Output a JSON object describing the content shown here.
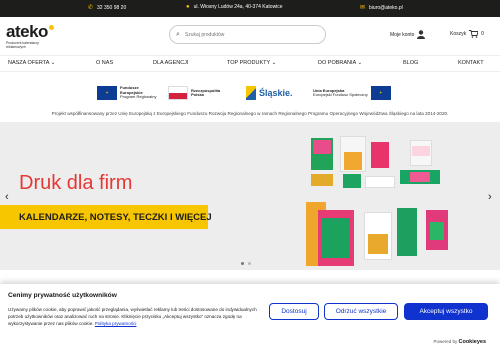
{
  "topbar": {
    "phone": "32 350 98 20",
    "address": "ul. Wiosny Ludów 24a, 40-374 Katowice",
    "email": "biuro@ateko.pl",
    "icons": {
      "phone": "phone-icon",
      "address": "location-pin-icon",
      "email": "envelope-icon"
    }
  },
  "header": {
    "logo_text": "ateko",
    "logo_tagline": "Producent kalendarzy reklamowych",
    "search_placeholder": "Szukaj produktów",
    "account_label": "Moje konto",
    "cart_label": "Koszyk",
    "cart_count": "0"
  },
  "nav": {
    "items": [
      "NASZA OFERTA",
      "O NAS",
      "DLA AGENCJI",
      "TOP PRODUKTY",
      "DO POBRANIA",
      "BLOG",
      "KONTAKT"
    ]
  },
  "funding": {
    "logos": [
      {
        "line1": "Fundusze",
        "line2": "Europejskie",
        "line3": "Program Regionalny"
      },
      {
        "line1": "Rzeczpospolita",
        "line2": "Polska"
      },
      {
        "text": "Śląskie."
      },
      {
        "line1": "Unia Europejska",
        "line2": "Europejski Fundusz Społeczny"
      }
    ],
    "note": "Projekt współfinansowany przez Unię Europejską z Europejskiego Funduszu Rozwoju Regionalnego w ramach Regionalnego Programu Operacyjnego Województwa Śląskiego na lata 2014-2020."
  },
  "hero": {
    "title": "Druk dla firm",
    "subtitle": "KALENDARZE, NOTESY, TECZKI I WIĘCEJ",
    "slides": 2,
    "active_slide": 1
  },
  "cookie": {
    "title": "Cenimy prywatność użytkowników",
    "text": "Używamy plików cookie, aby poprawić jakość przeglądania, wyświetlać reklamy lub treści dostosowane do indywidualnych potrzeb użytkowników oraz analizować ruch na stronie. Kliknięcie przycisku „Akceptuj wszystko” oznacza zgodę na wykorzystywanie przez nas plików cookie.",
    "policy_link": "Polityka prywatności",
    "buttons": {
      "customize": "Dostosuj",
      "reject": "Odrzuć wszystkie",
      "accept": "Akceptuj wszystko"
    },
    "powered_by": "Powered by",
    "brand": "Cookieyes"
  },
  "colors": {
    "accent": "#f7c600",
    "hero_title": "#e53935",
    "button_blue": "#1032cf",
    "topbar_bg": "#1d1d1b"
  }
}
